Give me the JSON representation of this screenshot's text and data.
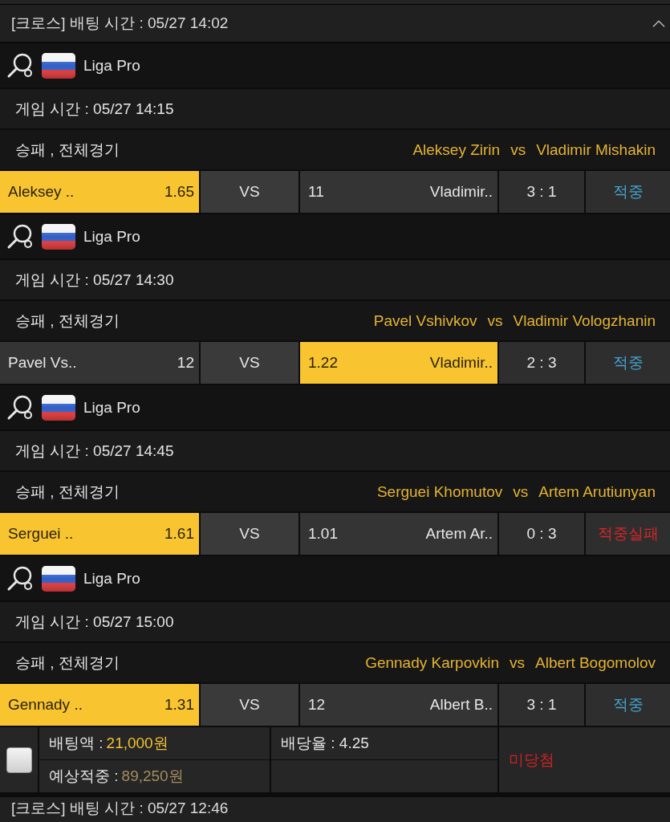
{
  "header": {
    "title": "[크로스] 배팅 시간 : 05/27 14:02",
    "expanded": true
  },
  "games": [
    {
      "league": "Liga Pro",
      "game_time": "게임 시간 : 05/27 14:15",
      "market": "승패 , 전체경기",
      "matchup": {
        "home": "Aleksey Zirin",
        "vs": "vs",
        "away": "Vladimir Mishakin"
      },
      "home": {
        "name": "Aleksey ..",
        "odds": "1.65",
        "selected": true
      },
      "draw": "VS",
      "away": {
        "odds": "11",
        "name": "Vladimir..",
        "selected": false
      },
      "score": "3 : 1",
      "result": {
        "text": "적중",
        "kind": "hit"
      }
    },
    {
      "league": "Liga Pro",
      "game_time": "게임 시간 : 05/27 14:30",
      "market": "승패 , 전체경기",
      "matchup": {
        "home": "Pavel Vshivkov",
        "vs": "vs",
        "away": "Vladimir Vologzhanin"
      },
      "home": {
        "name": "Pavel Vs..",
        "odds": "12",
        "selected": false
      },
      "draw": "VS",
      "away": {
        "odds": "1.22",
        "name": "Vladimir..",
        "selected": true
      },
      "score": "2 : 3",
      "result": {
        "text": "적중",
        "kind": "hit"
      }
    },
    {
      "league": "Liga Pro",
      "game_time": "게임 시간 : 05/27 14:45",
      "market": "승패 , 전체경기",
      "matchup": {
        "home": "Serguei Khomutov",
        "vs": "vs",
        "away": "Artem Arutiunyan"
      },
      "home": {
        "name": "Serguei ..",
        "odds": "1.61",
        "selected": true
      },
      "draw": "VS",
      "away": {
        "odds": "1.01",
        "name": "Artem Ar..",
        "selected": false
      },
      "score": "0 : 3",
      "result": {
        "text": "적중실패",
        "kind": "miss"
      }
    },
    {
      "league": "Liga Pro",
      "game_time": "게임 시간 : 05/27 15:00",
      "market": "승패 , 전체경기",
      "matchup": {
        "home": "Gennady Karpovkin",
        "vs": "vs",
        "away": "Albert Bogomolov"
      },
      "home": {
        "name": "Gennady ..",
        "odds": "1.31",
        "selected": true
      },
      "draw": "VS",
      "away": {
        "odds": "12",
        "name": "Albert B..",
        "selected": false
      },
      "score": "3 : 1",
      "result": {
        "text": "적중",
        "kind": "hit"
      }
    }
  ],
  "summary": {
    "checked": false,
    "bet_amount": {
      "label": "배팅액 :",
      "value": "21,000원"
    },
    "odds": "배당율 : 4.25",
    "expected_win": {
      "label": "예상적중 :",
      "value": "89,250원"
    },
    "status": {
      "text": "미당첨",
      "kind": "lost"
    }
  },
  "next_header": {
    "title": "[크로스] 배팅 시간 : 05/27 12:46"
  }
}
